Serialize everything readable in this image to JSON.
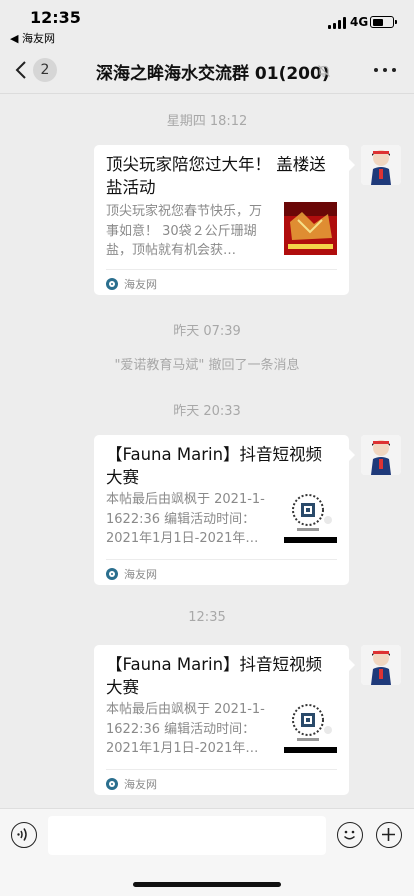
{
  "status_bar": {
    "time": "12:35",
    "back_app": "◀ 海友网",
    "network": "4G"
  },
  "nav": {
    "unread_count": "2",
    "title": "深海之眸海水交流群 01(200)"
  },
  "messages": [
    {
      "kind": "time",
      "text": "星期四 18:12"
    },
    {
      "kind": "card",
      "title": "顶尖玩家陪您过大年！ 盖楼送盐活动",
      "desc": "顶尖玩家祝您春节快乐，万事如意！ 30袋２公斤珊瑚盐，顶帖就有机会获…",
      "source": "海友网",
      "thumb": "red-poster"
    },
    {
      "kind": "time",
      "text": "昨天 07:39"
    },
    {
      "kind": "system",
      "text": "\"爱诺教育马斌\" 撤回了一条消息"
    },
    {
      "kind": "time",
      "text": "昨天 20:33"
    },
    {
      "kind": "card",
      "title": "【Fauna Marin】抖音短视频大赛",
      "desc": "本帖最后由飒枫于 2021-1-1622:36 编辑活动时间：2021年1月1日-2021年…",
      "source": "海友网",
      "thumb": "qr-code"
    },
    {
      "kind": "time",
      "text": "12:35"
    },
    {
      "kind": "card",
      "title": "【Fauna Marin】抖音短视频大赛",
      "desc": "本帖最后由飒枫于 2021-1-1622:36 编辑活动时间：2021年1月1日-2021年…",
      "source": "海友网",
      "thumb": "qr-code"
    }
  ],
  "icons": {
    "back": "chevron-left-icon",
    "mute": "mute-bell-icon",
    "more": "more-dots-icon",
    "voice": "voice-icon",
    "emoji": "emoji-icon",
    "plus": "plus-icon"
  },
  "colors": {
    "background": "#ededed",
    "card": "#ffffff",
    "muted_text": "#a8a8a8"
  }
}
